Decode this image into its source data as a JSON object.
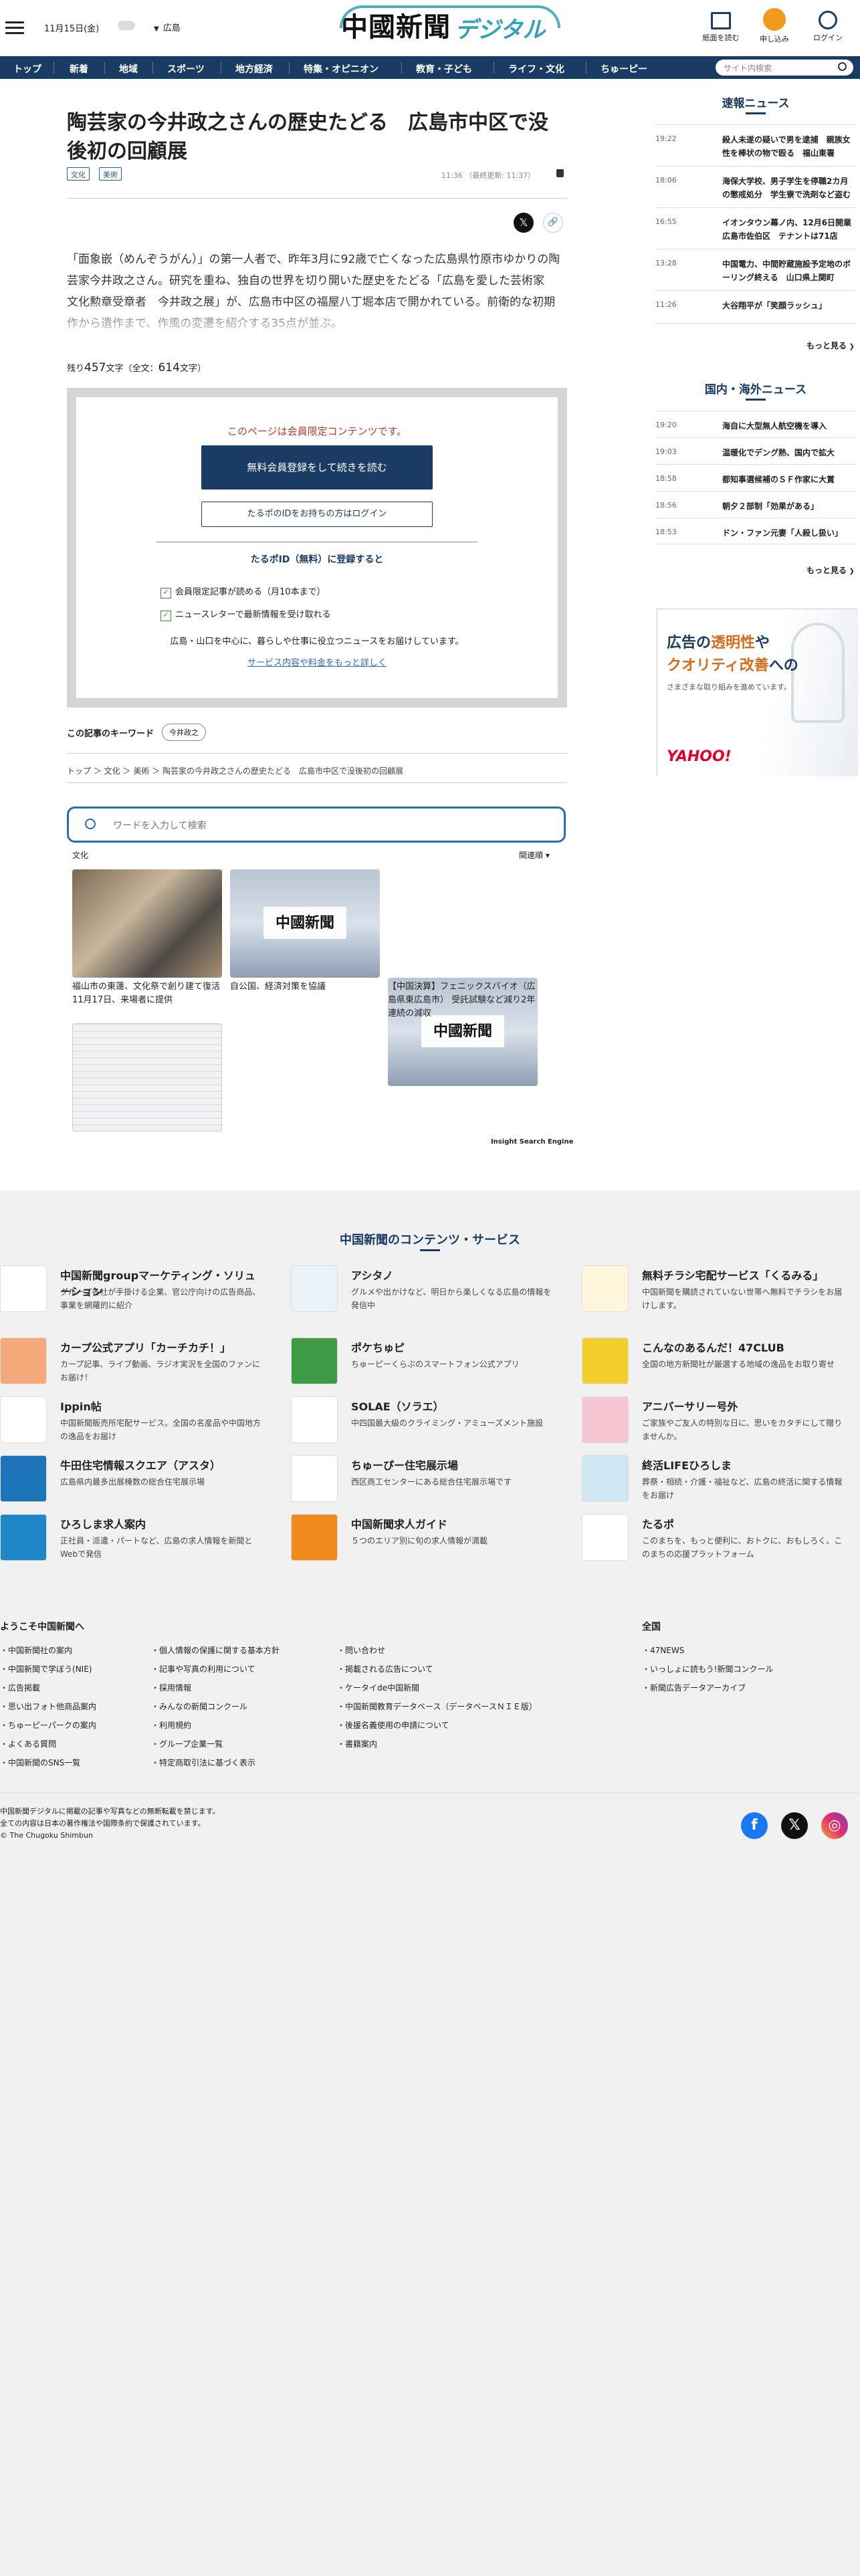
{
  "header": {
    "date": "11月15日(金)",
    "location": "広島",
    "logo_main": "中國新聞",
    "logo_sub": "デジタル",
    "buttons": [
      {
        "label": "紙面を読む"
      },
      {
        "label": "申し込み"
      },
      {
        "label": "ログイン"
      }
    ]
  },
  "nav": {
    "items": [
      "トップ",
      "新着",
      "地域",
      "スポーツ",
      "地方経済",
      "特集・オピニオン",
      "教育・子ども",
      "ライフ・文化",
      "ちゅーピー"
    ],
    "search_placeholder": "サイト内検索"
  },
  "article": {
    "title": "陶芸家の今井政之さんの歴史たどる　広島市中区で没後初の回顧展",
    "tags": [
      "文化",
      "美術"
    ],
    "time": "11:36",
    "updated": "（最終更新: 11:37）",
    "lead": "「面象嵌（めんぞうがん）」の第一人者で、昨年3月に92歳で亡くなった広島県竹原市ゆかりの陶芸家今井政之さん。研究を重ね、独自の世界を切り開いた歴史をたどる「広島を愛した芸術家　文化勲章受章者　今井政之展」が、広島市中区の福屋八丁堀本店で開かれている。前衛的な初期作から遺作まで、作風の変遷を紹介する35点が並ぶ。",
    "remain_prefix": "残り",
    "remain_count": "457",
    "remain_mid": "文字（全文：",
    "total_count": "614",
    "remain_suffix": "文字）"
  },
  "paywall": {
    "message": "このページは会員限定コンテンツです。",
    "register": "無料会員登録をして続きを読む",
    "login": "たるポのIDをお持ちの方はログイン",
    "id_head": "たるポID（無料）に登録すると",
    "check1": "会員限定記事が読める（月10本まで）",
    "check2": "ニュースレターで最新情報を受け取れる",
    "desc": "広島・山口を中心に、暮らしや仕事に役立つニュースをお届けしています。",
    "more": "サービス内容や料金をもっと詳しく"
  },
  "keywords": {
    "label": "この記事のキーワード",
    "items": [
      "今井政之"
    ]
  },
  "breadcrumb": [
    "トップ",
    "文化",
    "美術",
    "陶芸家の今井政之さんの歴史たどる　広島市中区で没後初の回顧展"
  ],
  "search": {
    "placeholder": "ワードを入力して検索",
    "category": "文化",
    "sort": "関連順"
  },
  "related": [
    {
      "caption": "福山市の東蓮、文化祭で創り建て復活　11月17日、来場者に提供"
    },
    {
      "caption": "自公国、経済対策を協議"
    },
    {
      "caption": "【中国決算】フェニックスバイオ（広島県東広島市） 受託試験など減り2年連続の減収"
    },
    {
      "caption": ""
    },
    {
      "caption": ""
    },
    {
      "caption": ""
    }
  ],
  "ise_label": "Insight Search Engine",
  "sidebar": {
    "breaking_title": "速報ニュース",
    "breaking": [
      {
        "time": "19:22",
        "text": "殺人未遂の疑いで男を逮捕　親族女性を棒状の物で殴る　福山東署"
      },
      {
        "time": "18:06",
        "text": "海保大学校、男子学生を停職2カ月の懲戒処分　学生寮で洗剤など盗む"
      },
      {
        "time": "16:55",
        "text": "イオンタウン幕ノ内、12月6日開業　広島市佐伯区　テナントは71店"
      },
      {
        "time": "13:28",
        "text": "中国電力、中間貯蔵施設予定地のボーリング終える　山口県上関町"
      },
      {
        "time": "11:26",
        "text": "大谷翔平が「笑顔ラッシュ」"
      }
    ],
    "more": "もっと見る",
    "world_title": "国内・海外ニュース",
    "world": [
      {
        "time": "19:20",
        "text": "海自に大型無人航空機を導入"
      },
      {
        "time": "19:03",
        "text": "温暖化でデング熱、国内で拡大"
      },
      {
        "time": "18:58",
        "text": "都知事選候補のＳＦ作家に大賞"
      },
      {
        "time": "18:56",
        "text": "朝夕２部制「効果がある」"
      },
      {
        "time": "18:53",
        "text": "ドン・ファン元妻「人殺し扱い」"
      }
    ],
    "ad": {
      "l1a": "広告の",
      "l1b": "透明性",
      "l1c": "や",
      "l2a": "クオリティ",
      "l2b": "改善",
      "l2c": "への",
      "l3": "さまざまな取り組みを進めています。",
      "brand": "YAHOO!"
    }
  },
  "services": {
    "title": "中国新聞のコンテンツ・サービス",
    "items": [
      {
        "name": "中国新聞groupマーケティング・ソリューション",
        "desc": "グループ各社が手掛ける企業、官公庁向けの広告商品、事業を網羅的に紹介",
        "color": "#ffffff",
        "icon": "group-logo-icon"
      },
      {
        "name": "アシタノ",
        "desc": "グルメや出かけなど、明日から楽しくなる広島の情報を発信中",
        "color": "#e9f2f8",
        "icon": "ashitano-icon"
      },
      {
        "name": "無料チラシ宅配サービス「くるみる」",
        "desc": "中国新聞を購読されていない世帯へ無料でチラシをお届けします。",
        "color": "#fff6dc",
        "icon": "kurumiru-icon"
      },
      {
        "name": "カープ公式アプリ「カーチカチ！」",
        "desc": "カープ記事、ライブ動画、ラジオ実況を全国のファンにお届け！",
        "color": "#f4a97a",
        "icon": "carp-app-icon"
      },
      {
        "name": "ポケちゅピ",
        "desc": "ちゅーピーくらぶのスマートフォン公式アプリ",
        "color": "#3d9b45",
        "icon": "pokechupi-icon"
      },
      {
        "name": "こんなのあるんだ！47CLUB",
        "desc": "全国の地方新聞社が厳選する地域の逸品をお取り寄せ",
        "color": "#f2cf2a",
        "icon": "47club-icon"
      },
      {
        "name": "Ippin帖",
        "desc": "中国新聞販売所宅配サービス。全国の名産品や中国地方の逸品をお届け",
        "color": "#ffffff",
        "icon": "ippin-icon"
      },
      {
        "name": "SOLAE（ソラエ）",
        "desc": "中四国最大級のクライミング・アミューズメント施設",
        "color": "#ffffff",
        "icon": "solae-icon"
      },
      {
        "name": "アニバーサリー号外",
        "desc": "ご家族やご友人の特別な日に、思いをカタチにして贈りませんか。",
        "color": "#f6c6d2",
        "icon": "anniversary-icon"
      },
      {
        "name": "牛田住宅情報スクエア（アスタ）",
        "desc": "広島県内最多出展棟数の総合住宅展示場",
        "color": "#1d74b8",
        "icon": "asta-icon"
      },
      {
        "name": "ちゅーぴー住宅展示場",
        "desc": "西区商工センターにある総合住宅展示場です",
        "color": "#ffffff",
        "icon": "house-icon"
      },
      {
        "name": "終活LIFEひろしま",
        "desc": "葬祭・相続・介護・福祉など、広島の終活に関する情報をお届け",
        "color": "#cfe6f3",
        "icon": "shukatsu-icon"
      },
      {
        "name": "ひろしま求人案内",
        "desc": "正社員・派遣・パートなど、広島の求人情報を新聞とWebで発信",
        "color": "#1f86c7",
        "icon": "kyujin-icon"
      },
      {
        "name": "中国新聞求人ガイド",
        "desc": "５つのエリア別に旬の求人情報が満載",
        "color": "#f08a1c",
        "icon": "guide-icon"
      },
      {
        "name": "たるポ",
        "desc": "このまちを、もっと便利に、おトクに、おもしろく。このまちの応援プラットフォーム",
        "color": "#ffffff",
        "icon": "tarupo-icon"
      }
    ]
  },
  "footer": {
    "welcome": "ようこそ中国新聞へ",
    "national": "全国",
    "col1": [
      "中国新聞社の案内",
      "中国新聞で学ぼう(NIE)",
      "広告掲載",
      "思い出フォト他商品案内",
      "ちゅーピーパークの案内",
      "よくある質問",
      "中国新聞のSNS一覧"
    ],
    "col2": [
      "個人情報の保護に関する基本方針",
      "記事や写真の利用について",
      "採用情報",
      "みんなの新聞コンクール",
      "利用規約",
      "グループ企業一覧",
      "特定商取引法に基づく表示"
    ],
    "col3": [
      "問い合わせ",
      "掲載される広告について",
      "ケータイde中国新聞",
      "中国新聞教育データベース（データベースＮＩＥ版）",
      "後援名義使用の申請について",
      "書籍案内"
    ],
    "col4": [
      "47NEWS",
      "いっしょに読もう!新聞コンクール",
      "新聞広告データアーカイブ"
    ],
    "copy1": "中国新聞デジタルに掲載の記事や写真などの無断転載を禁じます。",
    "copy2": "全ての内容は日本の著作権法や国際条約で保護されています。",
    "copy3": "© The Chugoku Shimbun"
  }
}
